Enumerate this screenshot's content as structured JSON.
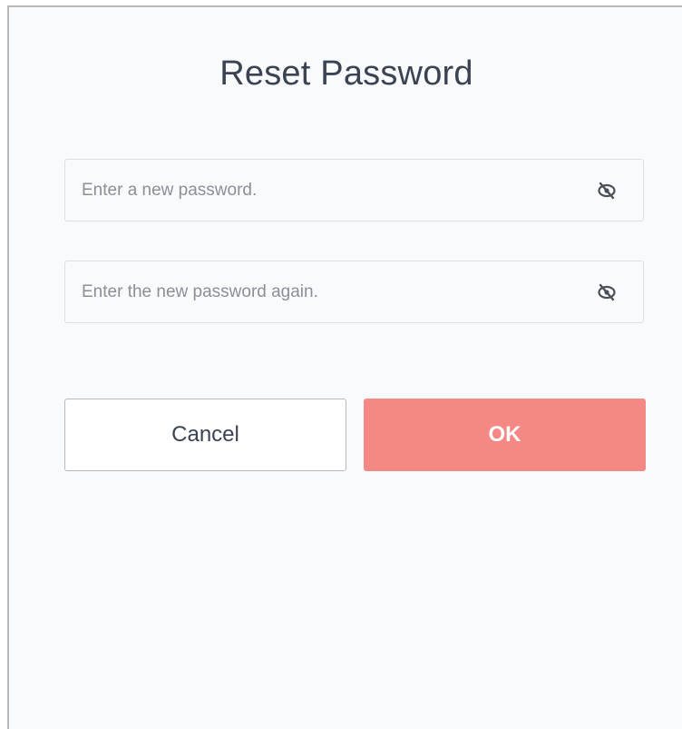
{
  "dialog": {
    "title": "Reset Password",
    "fields": [
      {
        "placeholder": "Enter a new password.",
        "value": "",
        "toggle_icon": "eye-slash-icon"
      },
      {
        "placeholder": "Enter the new password again.",
        "value": "",
        "toggle_icon": "eye-slash-icon"
      }
    ],
    "buttons": {
      "cancel_label": "Cancel",
      "ok_label": "OK"
    }
  },
  "colors": {
    "background": "#f9fafc",
    "text": "#3b4352",
    "placeholder": "#8b8f98",
    "field_border": "#dcdfe6",
    "ok_button": "#f38885"
  }
}
